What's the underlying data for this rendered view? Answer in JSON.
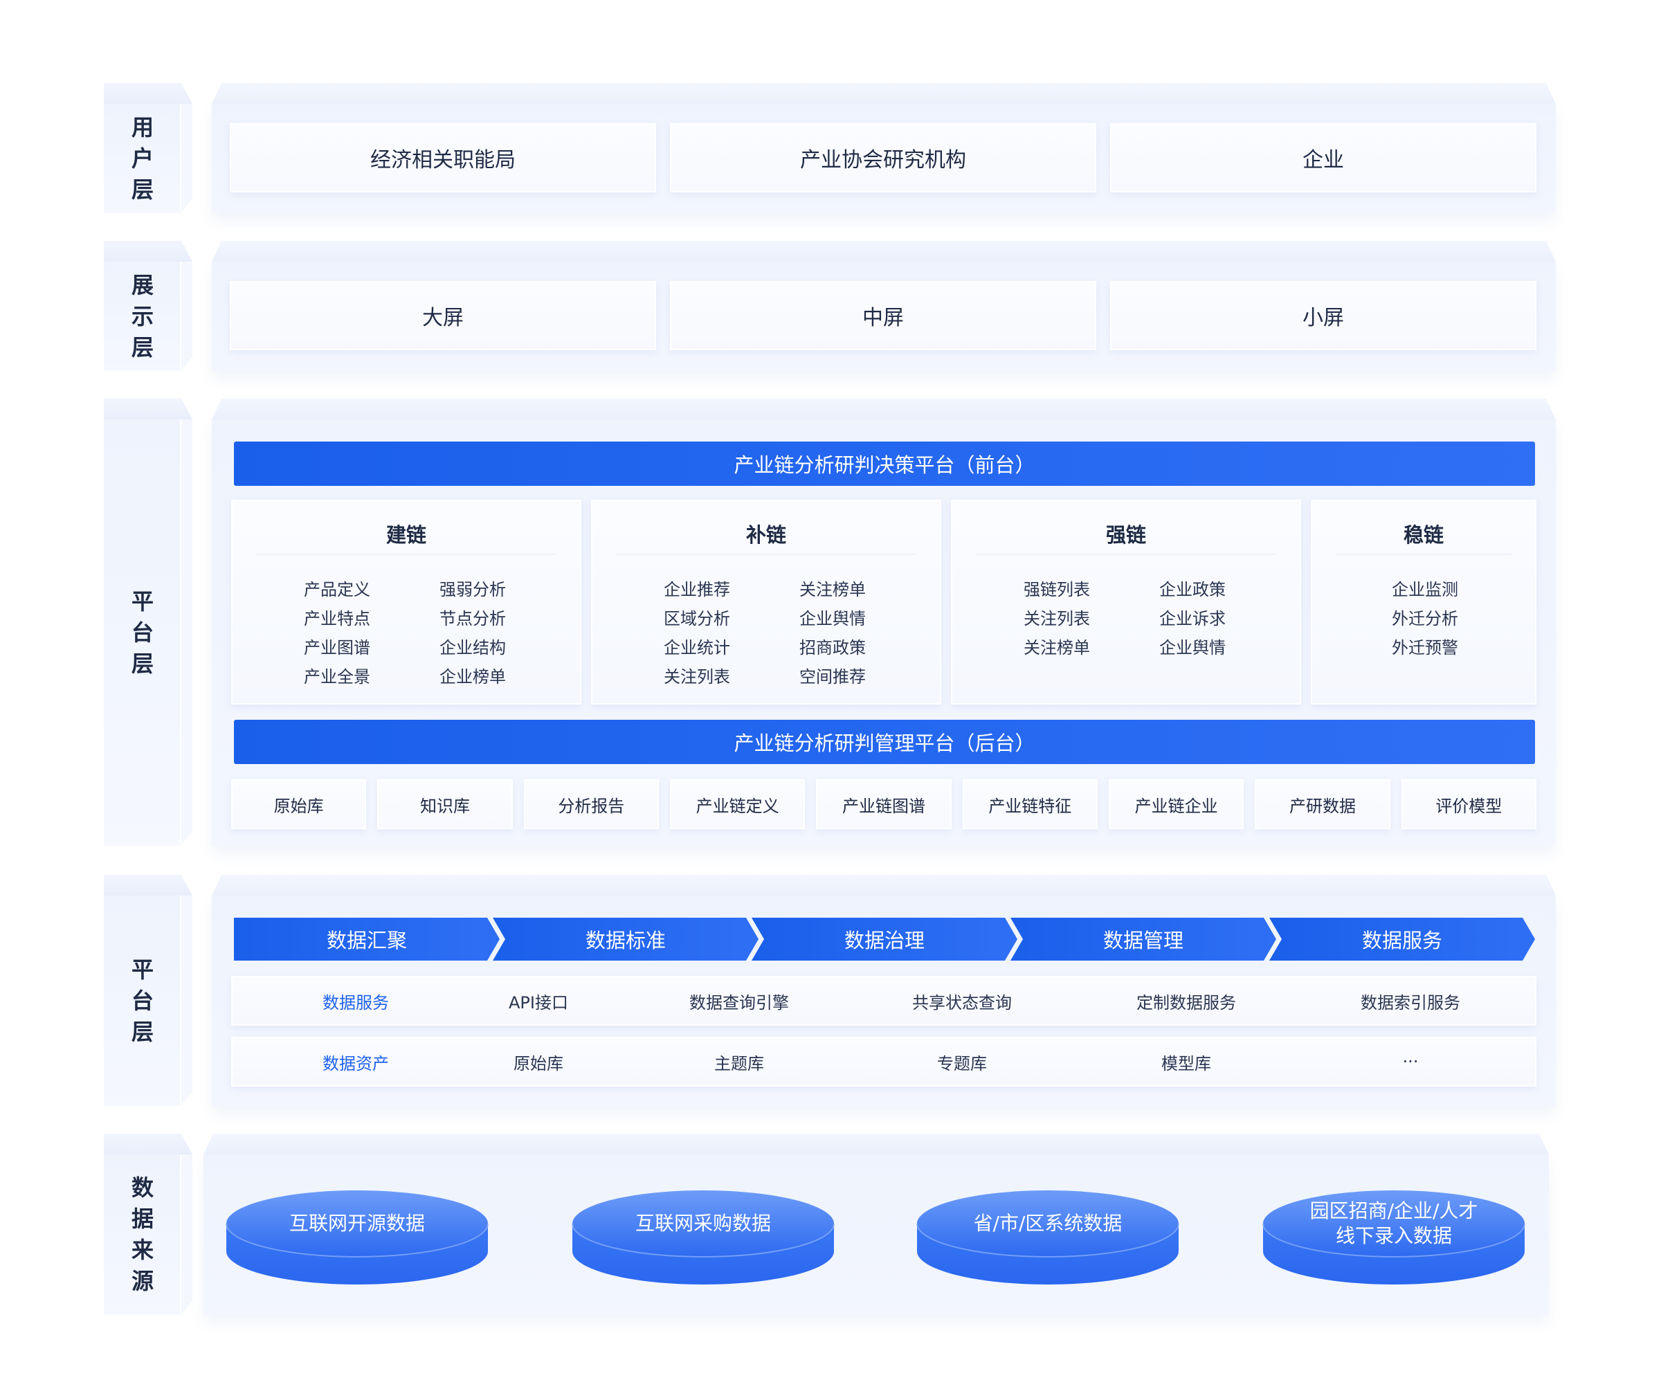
{
  "layers": {
    "user": {
      "label": "用户层",
      "items": [
        "经济相关职能局",
        "产业协会研究机构",
        "企业"
      ]
    },
    "display": {
      "label": "展示层",
      "items": [
        "大屏",
        "中屏",
        "小屏"
      ]
    },
    "platform": {
      "label": "平台层",
      "front_title": "产业链分析研判决策平台（前台）",
      "groups": [
        {
          "title": "建链",
          "col1": [
            "产品定义",
            "产业特点",
            "产业图谱",
            "产业全景"
          ],
          "col2": [
            "强弱分析",
            "节点分析",
            "企业结构",
            "企业榜单"
          ]
        },
        {
          "title": "补链",
          "col1": [
            "企业推荐",
            "区域分析",
            "企业统计",
            "关注列表"
          ],
          "col2": [
            "关注榜单",
            "企业舆情",
            "招商政策",
            "空间推荐"
          ]
        },
        {
          "title": "强链",
          "col1": [
            "强链列表",
            "关注列表",
            "关注榜单"
          ],
          "col2": [
            "企业政策",
            "企业诉求",
            "企业舆情"
          ]
        },
        {
          "title": "稳链",
          "col1": [
            "企业监测",
            "外迁分析",
            "外迁预警"
          ],
          "col2": []
        }
      ],
      "back_title": "产业链分析研判管理平台（后台）",
      "back_items": [
        "原始库",
        "知识库",
        "分析报告",
        "产业链定义",
        "产业链图谱",
        "产业链特征",
        "产业链企业",
        "产研数据",
        "评价模型"
      ]
    },
    "data_platform": {
      "label": "平台层",
      "flow": [
        "数据汇聚",
        "数据标准",
        "数据治理",
        "数据管理",
        "数据服务"
      ],
      "service_row": {
        "title": "数据服务",
        "items": [
          "API接口",
          "数据查询引擎",
          "共享状态查询",
          "定制数据服务",
          "数据索引服务"
        ]
      },
      "asset_row": {
        "title": "数据资产",
        "items": [
          "原始库",
          "主题库",
          "专题库",
          "模型库",
          "···"
        ]
      }
    },
    "source": {
      "label": "数据来源",
      "items": [
        "互联网开源数据",
        "互联网采购数据",
        "省/市/区系统数据",
        "园区招商/企业/人才\n线下录入数据"
      ]
    }
  },
  "colors": {
    "accent": "#1e62ec",
    "panel_bg": "#eef3fd"
  }
}
